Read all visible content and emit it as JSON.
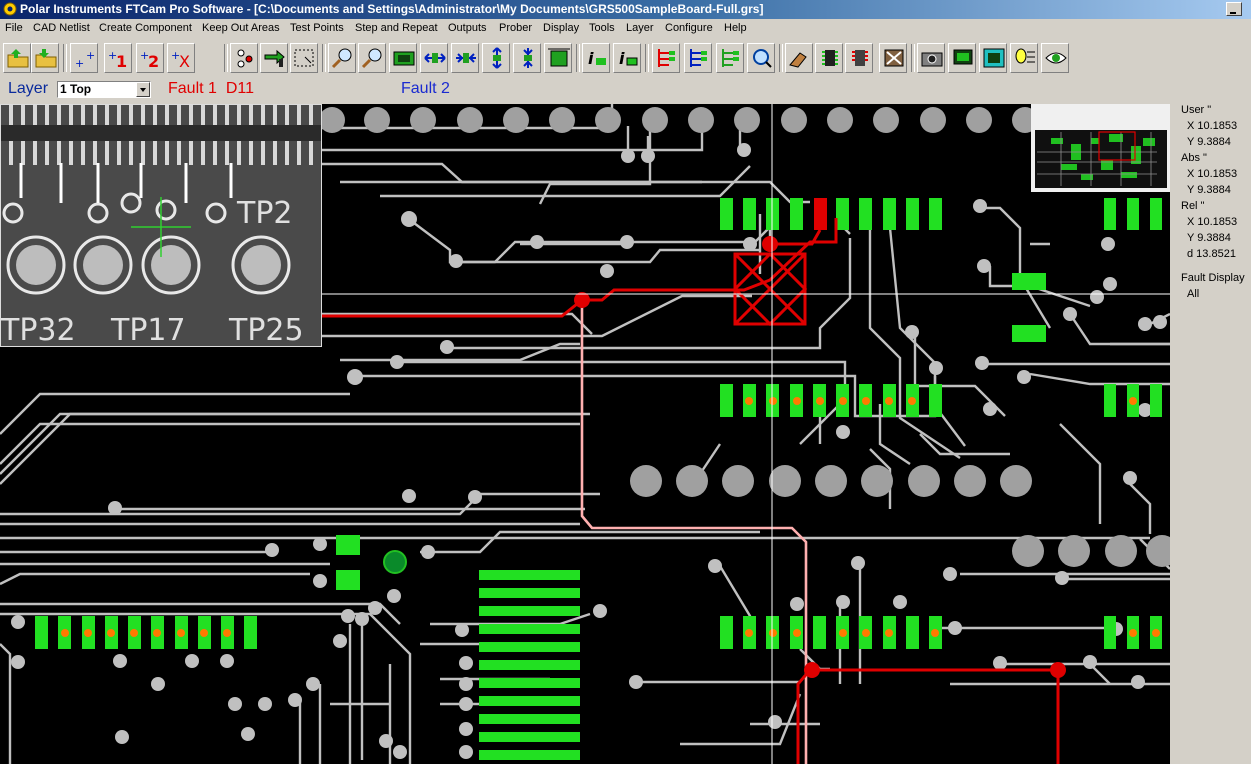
{
  "window": {
    "title": "Polar Instruments FTCam Pro Software - [C:\\Documents and Settings\\Administrator\\My Documents\\GRS500SampleBoard-Full.grs]"
  },
  "menu": [
    "File",
    "CAD Netlist",
    "Create Component",
    "Keep Out Areas",
    "Test Points",
    "Step and Repeat",
    "Outputs",
    "Prober",
    "Display",
    "Tools",
    "Layer",
    "Configure",
    "Help"
  ],
  "layer": {
    "label": "Layer",
    "selected": "1 Top"
  },
  "faults": {
    "fault1_label": "Fault 1",
    "fault1_ref": "D11",
    "fault2_label": "Fault 2"
  },
  "coords": {
    "user_label": "User \"",
    "user_x": "X 10.1853",
    "user_y": "Y 9.3884",
    "abs_label": "Abs \"",
    "abs_x": "X 10.1853",
    "abs_y": "Y 9.3884",
    "rel_label": "Rel \"",
    "rel_x": "X 10.1853",
    "rel_y": "Y 9.3884",
    "rel_d": "d 13.8521",
    "fault_display_label": "Fault Display",
    "fault_display_value": "All"
  },
  "camera": {
    "labels": [
      "TP32",
      "TP17",
      "TP25",
      "TP2"
    ]
  },
  "colors": {
    "pad_gray": "#a0a0a0",
    "pad_green": "#22e022",
    "fault_red": "#e00000",
    "trace_gray": "#c0c0c0"
  }
}
